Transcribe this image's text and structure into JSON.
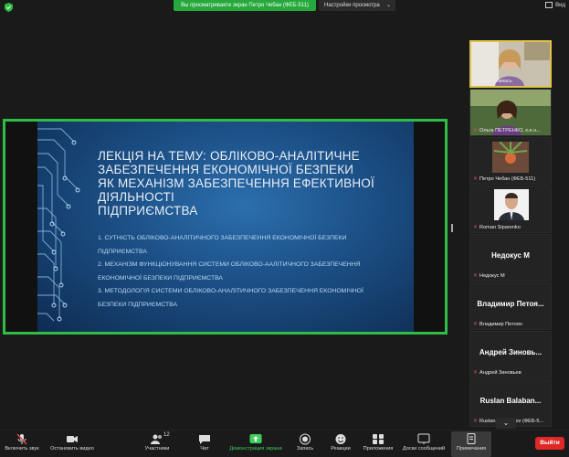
{
  "top_bar": {
    "share_banner": "Вы просматриваете экран Петро Чебан (ФЕБ-511)",
    "view_options": "Настройки просмотра",
    "view_button": "Вид"
  },
  "slide": {
    "title_lines": [
      "ЛЕКЦІЯ НА ТЕМУ: ОБЛІКОВО-АНАЛІТИЧНЕ",
      "ЗАБЕЗПЕЧЕННЯ ЕКОНОМІЧНОЇ БЕЗПЕКИ",
      "ЯК МЕХАНІЗМ ЗАБЕЗПЕЧЕННЯ ЕФЕКТИВНОЇ",
      "ДІЯЛЬНОСТІ",
      "ПІДПРИЄМСТВА"
    ],
    "list_lines": [
      "1. СУТНІСТЬ ОБЛІКОВО-АНАЛІТИЧНОГО ЗАБЕЗПЕЧЕННЯ ЕКОНОМІЧНОЇ БЕЗПЕКИ",
      "ПІДПРИЄМСТВА",
      "2. МЕХАНІЗМ ФУНКЦІОНУВАННЯ СИСТЕМИ ОБЛІКОВО-ААЛІТИЧНОГО ЗАБЕЗПЕЧЕННЯ",
      "ЕКОНОМІЧНОЇ БЕЗПЕКИ ПІДПРИЄМСТВА",
      "3. МЕТОДОЛОГІЯ СИСТЕМИ ОБЛІКОВО-АНАЛІТИЧНОГО ЗАБЕЗПЕЧЕННЯ ЕКОНОМІЧНОЇ",
      "БЕЗПЕКИ ПІДПРИЄМСТВА"
    ]
  },
  "participants": [
    {
      "name": "Галина Атамась",
      "big": "",
      "muted": false,
      "video": true
    },
    {
      "name": "Ольга ПЕТРЕНКО, к.е.н...",
      "big": "",
      "muted": true,
      "video": true
    },
    {
      "name": "Петро Чебан (ФЕБ-511)",
      "big": "",
      "muted": true,
      "video": true
    },
    {
      "name": "Roman Siparenko",
      "big": "",
      "muted": true,
      "video": true
    },
    {
      "name": "Недокус М",
      "big": "Недокус М",
      "muted": true,
      "video": false
    },
    {
      "name": "Владимир Петоян",
      "big": "Владимир Петоя...",
      "muted": true,
      "video": false
    },
    {
      "name": "Андрей Зиновьев",
      "big": "Андрей Зиновь...",
      "muted": true,
      "video": false
    },
    {
      "name": "Ruslan Balabanov (ФЕБ-5...",
      "big": "Ruslan Balaban...",
      "muted": true,
      "video": false
    }
  ],
  "toolbar": {
    "unmute": "Включить звук",
    "start_video": "Остановить видео",
    "participants": "Участники",
    "participants_count": "12",
    "chat": "Чат",
    "share_screen": "Демонстрация экрана",
    "record": "Запись",
    "reactions": "Реакции",
    "apps": "Приложения",
    "whiteboards": "Доски сообщений",
    "notes": "Примечания",
    "leave": "Выйти"
  },
  "colors": {
    "share_green": "#2fbd45",
    "active_speaker": "#e0c24a",
    "leave_red": "#e02828"
  }
}
